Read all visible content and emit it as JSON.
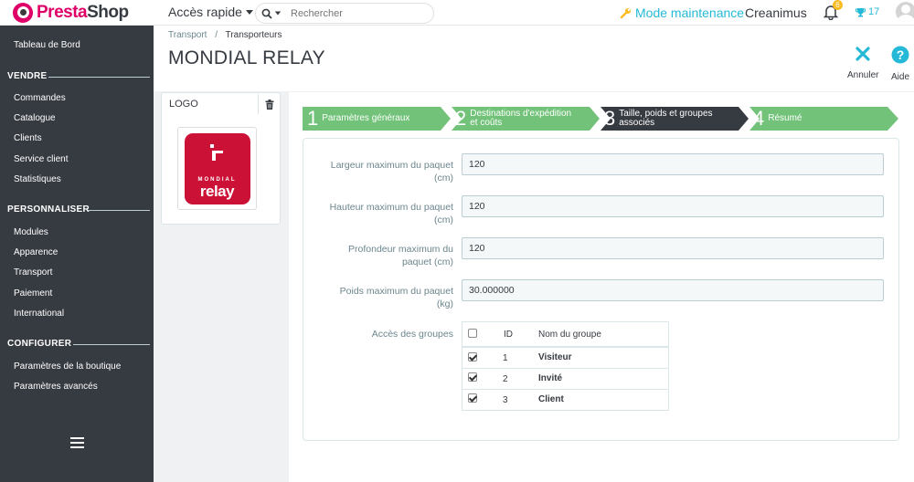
{
  "app": {
    "brand_a": "Presta",
    "brand_b": "Shop",
    "quick_access": "Accès rapide",
    "search_placeholder": "Rechercher",
    "maintenance": "Mode maintenance",
    "shop_name": "Creanimus",
    "notif_count": "6",
    "trophy_count": "17"
  },
  "sidebar": {
    "dashboard": "Tableau de Bord",
    "sections": [
      {
        "title": "VENDRE",
        "items": [
          "Commandes",
          "Catalogue",
          "Clients",
          "Service client",
          "Statistiques"
        ]
      },
      {
        "title": "PERSONNALISER",
        "items": [
          "Modules",
          "Apparence",
          "Transport",
          "Paiement",
          "International"
        ]
      },
      {
        "title": "CONFIGURER",
        "items": [
          "Paramètres de la boutique",
          "Paramètres avancés"
        ]
      }
    ]
  },
  "header": {
    "breadcrumb_parent": "Transport",
    "breadcrumb_sep": "/",
    "breadcrumb_current": "Transporteurs",
    "title": "MONDIAL RELAY",
    "cancel": "Annuler",
    "help": "Aide"
  },
  "logo_panel": {
    "label": "LOGO",
    "logo_top": "MONDIAL",
    "logo_bottom": "relay"
  },
  "steps": [
    {
      "num": "1",
      "line1": "Paramètres généraux",
      "line2": "",
      "color": "#72c279"
    },
    {
      "num": "2",
      "line1": "Destinations d'expédition",
      "line2": "et coûts",
      "color": "#72c279"
    },
    {
      "num": "3",
      "line1": "Taille, poids et groupes",
      "line2": "associés",
      "color": "#363a41"
    },
    {
      "num": "4",
      "line1": "Résumé",
      "line2": "",
      "color": "#72c279"
    }
  ],
  "form": {
    "fields": [
      {
        "label_1": "Largeur maximum du paquet",
        "label_2": "(cm)",
        "value": "120"
      },
      {
        "label_1": "Hauteur maximum du paquet",
        "label_2": "(cm)",
        "value": "120"
      },
      {
        "label_1": "Profondeur maximum du",
        "label_2": "paquet (cm)",
        "value": "120"
      },
      {
        "label_1": "Poids maximum du paquet",
        "label_2": "(kg)",
        "value": "30.000000"
      }
    ],
    "groups_label": "Accès des groupes",
    "groups_header": {
      "id": "ID",
      "name": "Nom du groupe"
    },
    "groups": [
      {
        "id": "1",
        "name": "Visiteur",
        "checked": true
      },
      {
        "id": "2",
        "name": "Invité",
        "checked": true
      },
      {
        "id": "3",
        "name": "Client",
        "checked": true
      }
    ]
  }
}
